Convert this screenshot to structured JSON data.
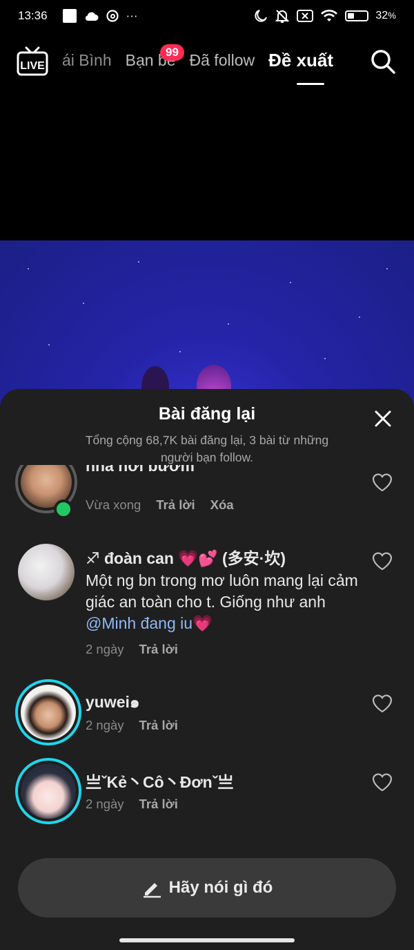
{
  "status_bar": {
    "time": "13:36",
    "more": "···",
    "battery": "32",
    "battery_unit": "%",
    "battery_level": 0.32
  },
  "nav": {
    "live_label": "LIVE",
    "tabs": [
      {
        "label": "ái Bình"
      },
      {
        "label": "Bạn bè"
      },
      {
        "label": "Đã follow"
      },
      {
        "label": "Đề xuất"
      }
    ],
    "friends_badge": "99"
  },
  "sheet": {
    "title": "Bài đăng lại",
    "subtitle": "Tổng cộng 68,7K bài đăng lại, 3 bài từ những người bạn follow."
  },
  "comments": [
    {
      "name": "nhà hơi bướm",
      "text": "",
      "time": "Vừa xong",
      "reply": "Trả lời",
      "delete": "Xóa"
    },
    {
      "name": "♐ đoàn can 💗💕 (多安·坎)",
      "text_before": "Một ng bn trong mơ luôn mang lại cảm giác an toàn cho t. Giống như anh ",
      "mention": "@Minh đang iu",
      "text_after": "💗",
      "time": "2 ngày",
      "reply": "Trả lời"
    },
    {
      "name": "yuwei๑",
      "time": "2 ngày",
      "reply": "Trả lời"
    },
    {
      "name": "亗ˇKẻ丶Cô丶Đơnˇ亗",
      "time": "2 ngày",
      "reply": "Trả lời"
    }
  ],
  "input": {
    "placeholder": "Hãy nói gì đó"
  },
  "colors": {
    "accent": "#fe2c55",
    "online": "#20c863",
    "ring": "#20d5ec",
    "mention": "#8fb9f2",
    "sheet_bg": "#1f1f1f"
  }
}
